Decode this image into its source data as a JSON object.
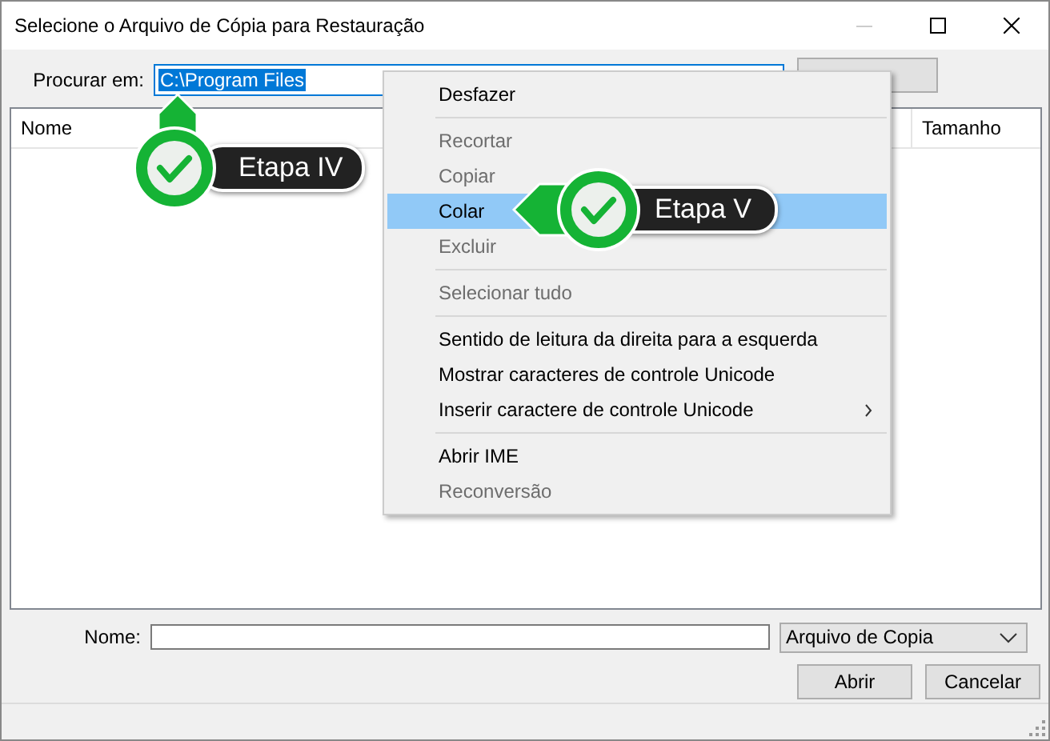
{
  "window": {
    "title": "Selecione o Arquivo de Cópia para Restauração"
  },
  "look_in": {
    "label": "Procurar em:",
    "value": "C:\\Program Files",
    "value_selected": true
  },
  "file_list": {
    "columns": [
      {
        "label": "Nome"
      },
      {
        "label": "Tamanho"
      }
    ]
  },
  "name_field": {
    "label": "Nome:"
  },
  "file_type": {
    "value": "Arquivo de Copia"
  },
  "buttons": [
    "Abrir",
    "Cancelar"
  ],
  "context_menu": {
    "items": [
      {
        "kind": "item",
        "label": "Desfazer",
        "disabled": false,
        "selected": false,
        "submenu": false
      },
      {
        "kind": "separator"
      },
      {
        "kind": "item",
        "label": "Recortar",
        "disabled": true,
        "selected": false,
        "submenu": false
      },
      {
        "kind": "item",
        "label": "Copiar",
        "disabled": true,
        "selected": false,
        "submenu": false
      },
      {
        "kind": "item",
        "label": "Colar",
        "disabled": false,
        "selected": true,
        "submenu": false
      },
      {
        "kind": "item",
        "label": "Excluir",
        "disabled": true,
        "selected": false,
        "submenu": false
      },
      {
        "kind": "separator"
      },
      {
        "kind": "item",
        "label": "Selecionar tudo",
        "disabled": true,
        "selected": false,
        "submenu": false
      },
      {
        "kind": "separator"
      },
      {
        "kind": "item",
        "label": "Sentido de leitura da direita para a esquerda",
        "disabled": false,
        "selected": false,
        "submenu": false
      },
      {
        "kind": "item",
        "label": "Mostrar caracteres de controle Unicode",
        "disabled": false,
        "selected": false,
        "submenu": false
      },
      {
        "kind": "item",
        "label": "Inserir caractere de controle Unicode",
        "disabled": false,
        "selected": false,
        "submenu": true
      },
      {
        "kind": "separator"
      },
      {
        "kind": "item",
        "label": "Abrir IME",
        "disabled": false,
        "selected": false,
        "submenu": false
      },
      {
        "kind": "item",
        "label": "Reconversão",
        "disabled": true,
        "selected": false,
        "submenu": false
      }
    ]
  },
  "callouts": [
    {
      "label": "Etapa IV"
    },
    {
      "label": "Etapa V"
    }
  ]
}
